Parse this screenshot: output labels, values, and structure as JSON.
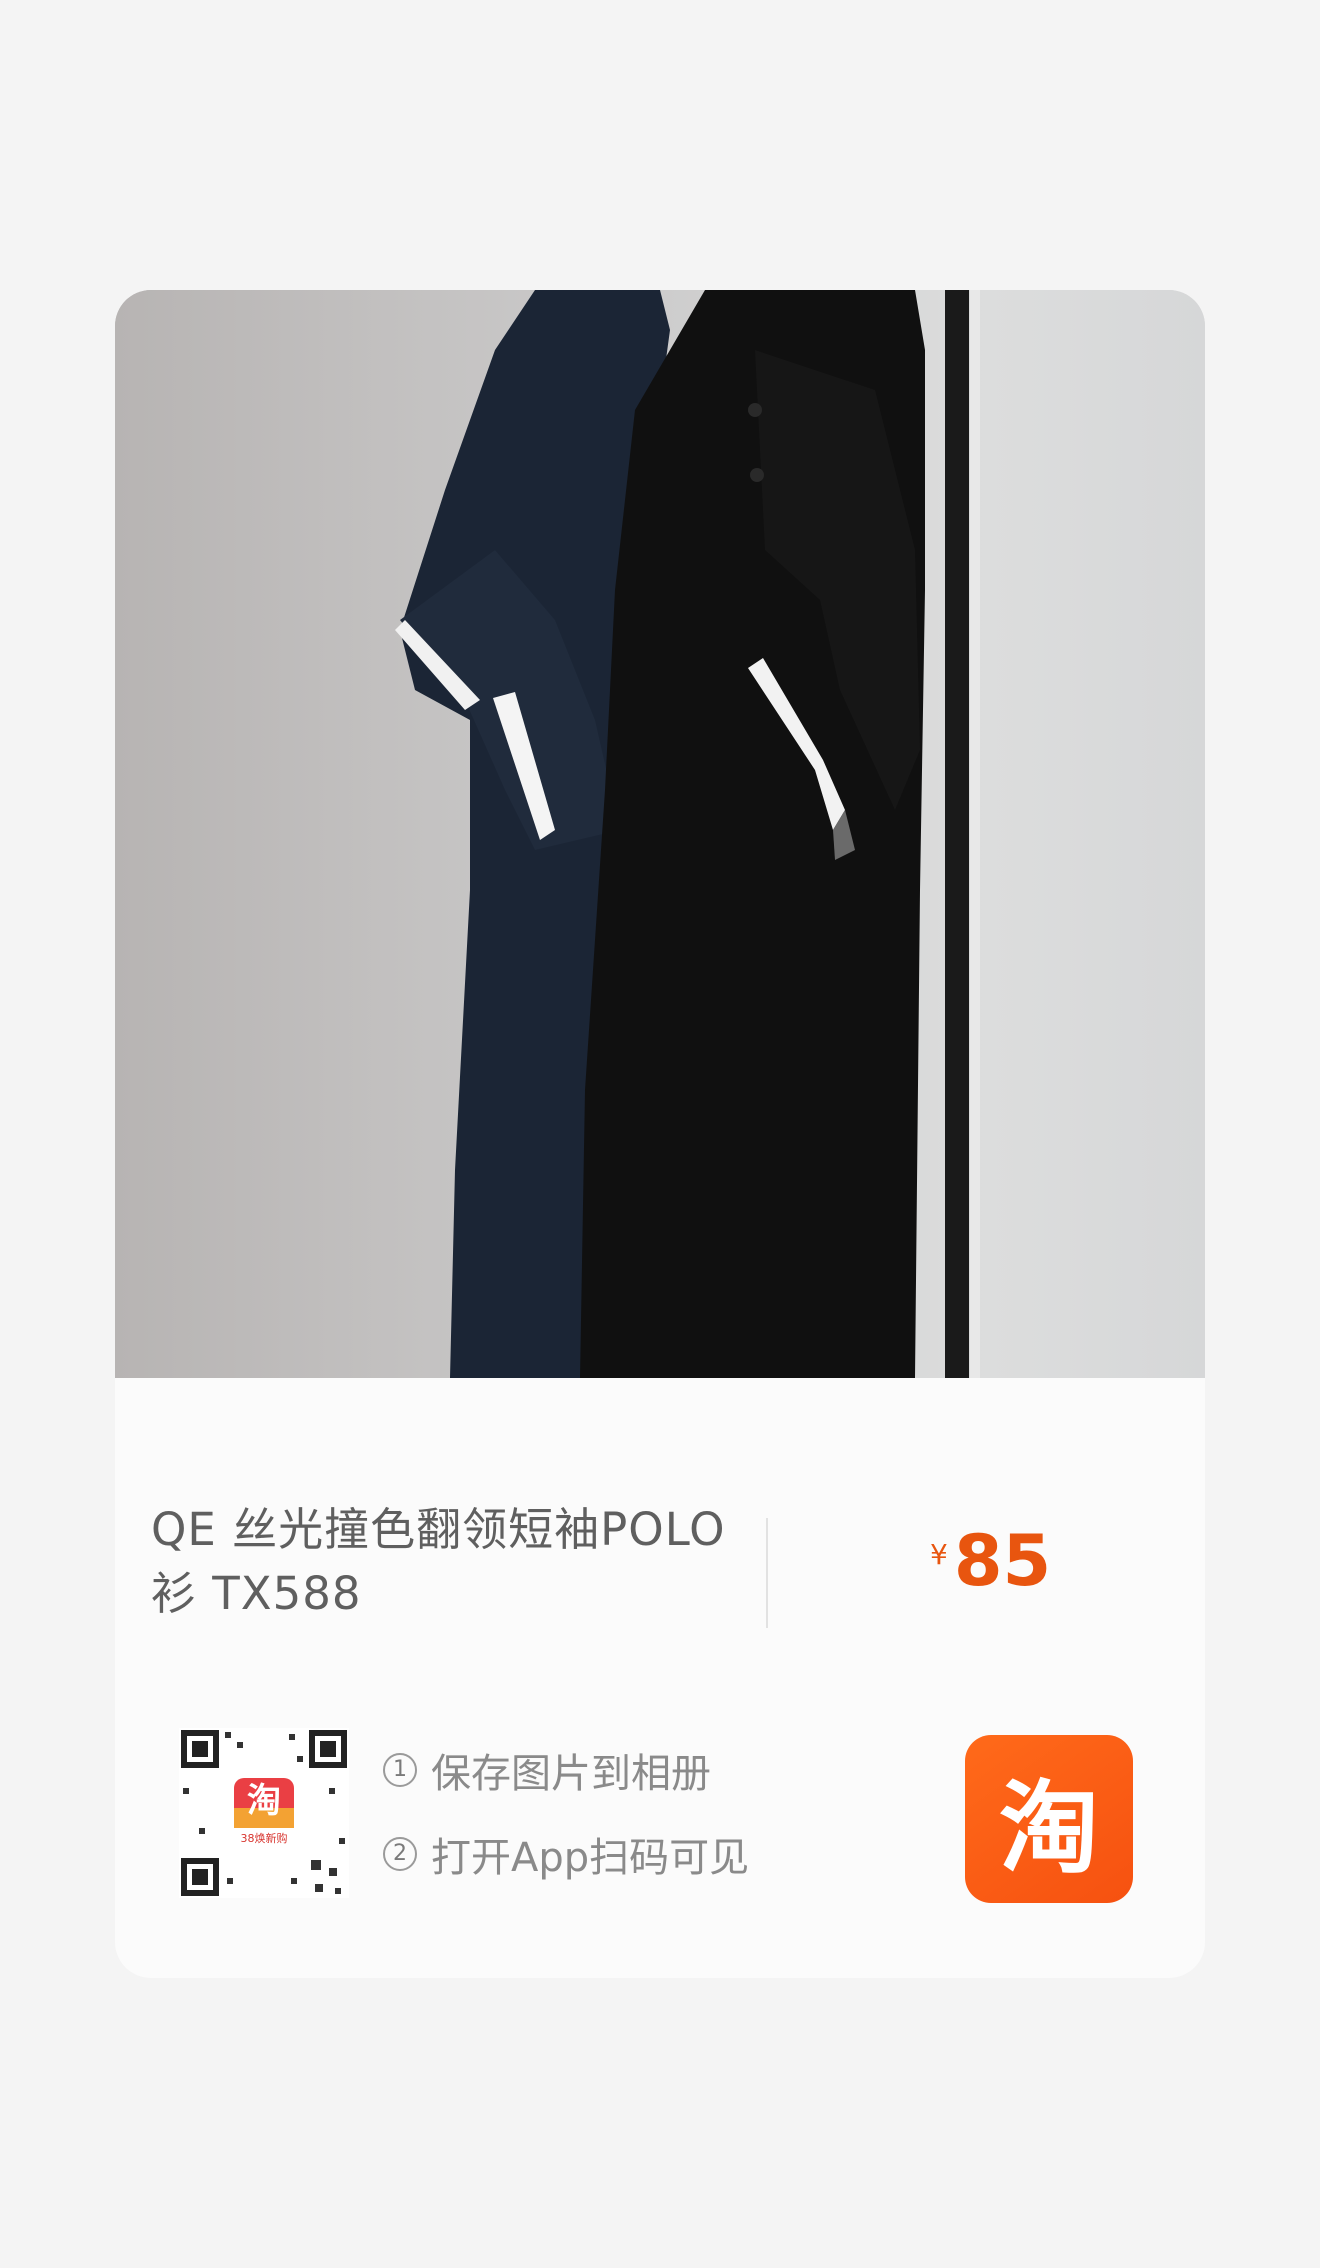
{
  "product": {
    "title": "QE 丝光撞色翻领短袖POLO衫 TX588",
    "price_currency": "¥",
    "price_amount": "85"
  },
  "qr": {
    "badge_text": "淘",
    "badge_caption": "38焕新购"
  },
  "steps": [
    {
      "num": "1",
      "text": "保存图片到相册"
    },
    {
      "num": "2",
      "text": "打开App扫码可见"
    }
  ],
  "app_button": {
    "glyph": "淘"
  },
  "colors": {
    "accent": "#e8550f",
    "app_icon": "#f65110",
    "background": "#f4f4f4"
  }
}
